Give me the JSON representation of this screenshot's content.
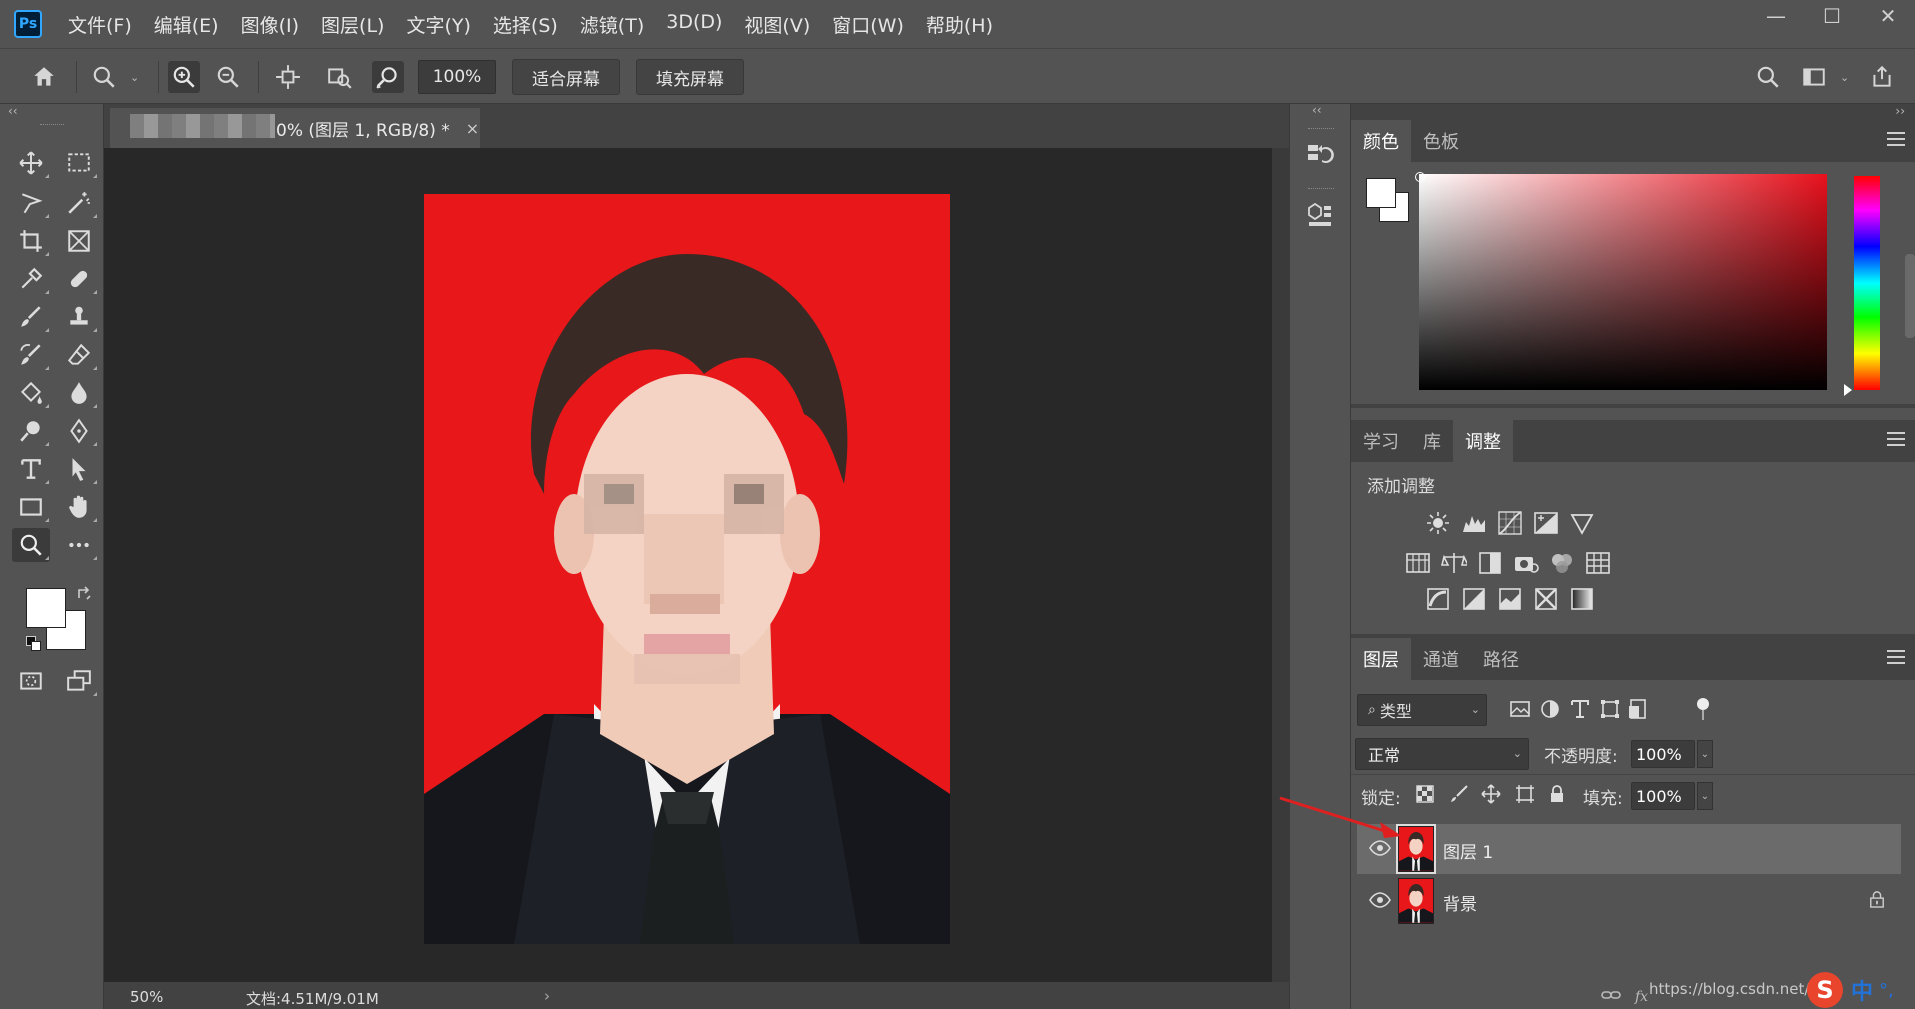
{
  "app": {
    "logo": "Ps"
  },
  "menu": [
    "文件(F)",
    "编辑(E)",
    "图像(I)",
    "图层(L)",
    "文字(Y)",
    "选择(S)",
    "滤镜(T)",
    "3D(D)",
    "视图(V)",
    "窗口(W)",
    "帮助(H)"
  ],
  "window_controls": {
    "minimize": "—",
    "maximize": "☐",
    "close": "✕"
  },
  "options": {
    "zoom_value": "100%",
    "fit_screen": "适合屏幕",
    "fill_screen": "填充屏幕"
  },
  "document": {
    "tab_title": "0% (图层 1, RGB/8) *",
    "tab_close": "×",
    "status_zoom": "50%",
    "status_doc": "文档:4.51M/9.01M",
    "status_arrow": "›"
  },
  "panels": {
    "collapse_left": "‹‹",
    "collapse_right": "››",
    "color_tabs": [
      {
        "label": "颜色",
        "active": true
      },
      {
        "label": "色板",
        "active": false
      }
    ],
    "adjust_tabs": [
      {
        "label": "学习",
        "active": false
      },
      {
        "label": "库",
        "active": false
      },
      {
        "label": "调整",
        "active": true
      }
    ],
    "adjust_title": "添加调整",
    "layer_tabs": [
      {
        "label": "图层",
        "active": true
      },
      {
        "label": "通道",
        "active": false
      },
      {
        "label": "路径",
        "active": false
      }
    ],
    "kind_label": "类型",
    "blend_mode": "正常",
    "opacity_label": "不透明度:",
    "opacity_value": "100%",
    "lock_label": "锁定:",
    "fill_label": "填充:",
    "fill_value": "100%",
    "layers": [
      {
        "name": "图层 1",
        "selected": true,
        "locked": false
      },
      {
        "name": "背景",
        "selected": false,
        "locked": true
      }
    ],
    "watermark": "https://blog.csdn.net/my",
    "ime_zh": "中",
    "ime_extra": "°,"
  },
  "colors": {
    "photo_bg": "#e8171a",
    "ps_blue": "#31a8ff",
    "annotation": "#e02020",
    "selected_layer": "#6b6b6b"
  }
}
